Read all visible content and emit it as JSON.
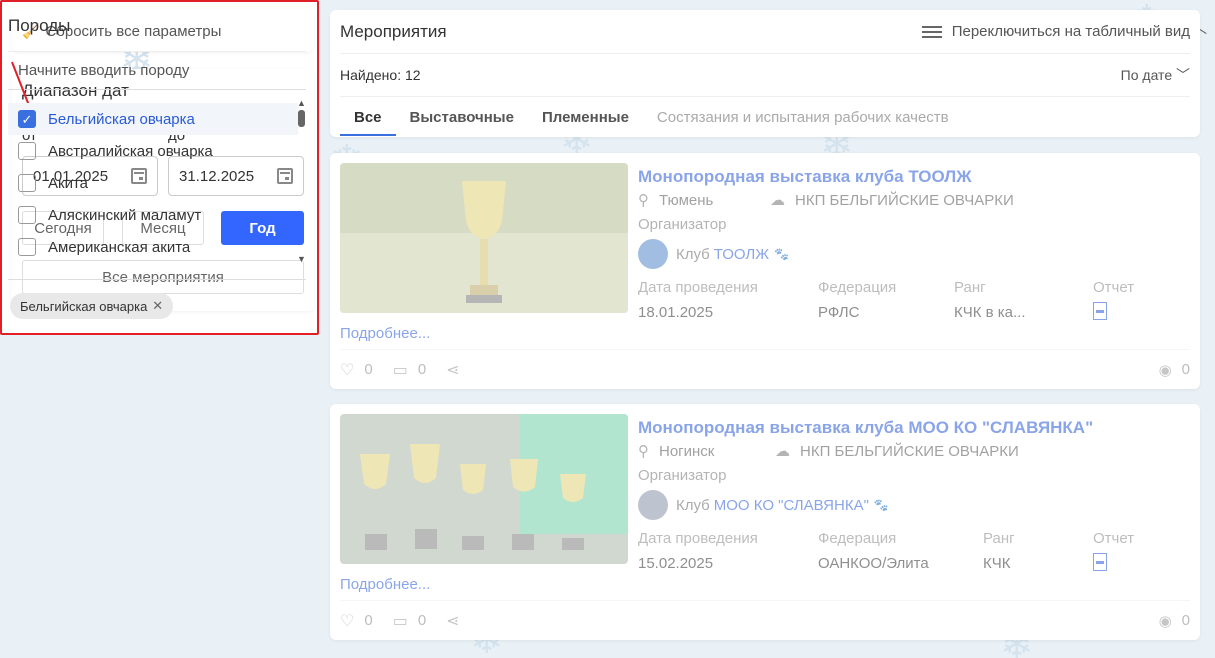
{
  "reset": {
    "label": "Сбросить все параметры"
  },
  "dates": {
    "title": "Диапазон дат",
    "from_label": "от",
    "to_label": "до",
    "from_value": "01.01.2025",
    "to_value": "31.12.2025",
    "buttons": [
      "Сегодня",
      "Месяц",
      "Год"
    ],
    "active_button": "Год",
    "all_events": "Все мероприятия"
  },
  "breeds": {
    "title": "Породы",
    "placeholder": "Начните вводить породу",
    "items": [
      {
        "label": "Бельгийская овчарка",
        "checked": true
      },
      {
        "label": "Австралийская овчарка",
        "checked": false
      },
      {
        "label": "Акита",
        "checked": false
      },
      {
        "label": "Аляскинский маламут",
        "checked": false
      },
      {
        "label": "Американская акита",
        "checked": false
      }
    ],
    "chip": "Бельгийская овчарка"
  },
  "events": {
    "title": "Мероприятия",
    "toggle": "Переключиться на табличный вид",
    "found": "Найдено: 12",
    "sort": "По дате",
    "tabs": [
      "Все",
      "Выставочные",
      "Племенные",
      "Состязания и испытания рабочих качеств"
    ],
    "active_tab": "Все"
  },
  "labels": {
    "organizer": "Организатор",
    "club_prefix": "Клуб",
    "date": "Дата проведения",
    "federation": "Федерация",
    "rank": "Ранг",
    "report": "Отчет",
    "more": "Подробнее..."
  },
  "cards": [
    {
      "name": "Монопородная выставка клуба ТООЛЖ",
      "city": "Тюмень",
      "org": "НКП БЕЛЬГИЙСКИЕ ОВЧАРКИ",
      "club": "ТООЛЖ",
      "date": "18.01.2025",
      "federation": "РФЛС",
      "rank": "КЧК в ка...",
      "likes": "0",
      "comments": "0",
      "views": "0"
    },
    {
      "name": "Монопородная выставка клуба МОО КО \"СЛАВЯНКА\"",
      "city": "Ногинск",
      "org": "НКП БЕЛЬГИЙСКИЕ ОВЧАРКИ",
      "club": "МОО КО \"СЛАВЯНКА\"",
      "date": "15.02.2025",
      "federation": "ОАНКОО/Элита",
      "rank": "КЧК",
      "likes": "0",
      "comments": "0",
      "views": "0"
    }
  ],
  "colors": {
    "accent": "#3366ff",
    "link": "#2a5ad8",
    "highlight_border": "#e21f26"
  }
}
